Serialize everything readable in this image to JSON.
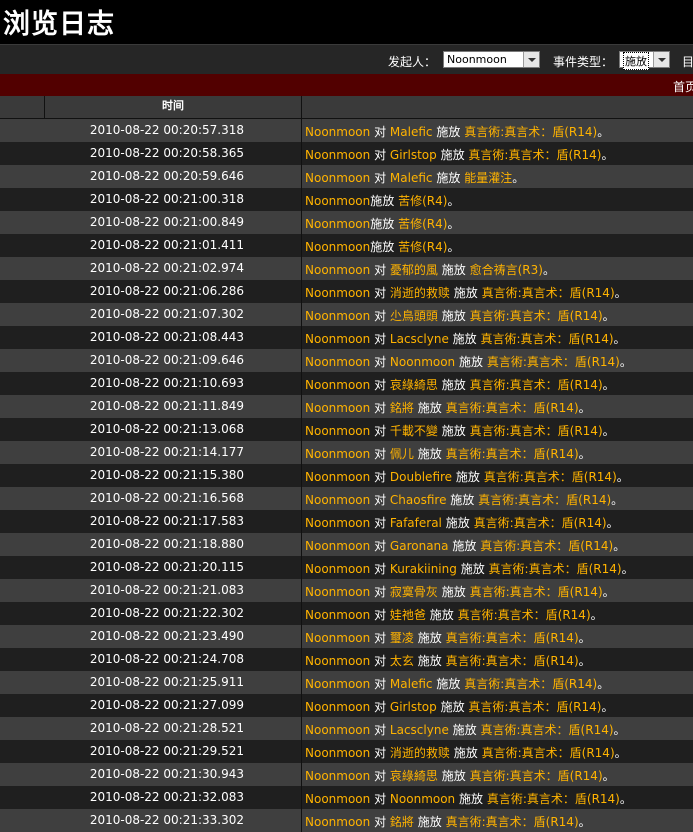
{
  "page": {
    "title": "浏览日志"
  },
  "filters": {
    "initiator_label": "发起人：",
    "initiator_value": "Noonmoon",
    "event_type_label": "事件类型：",
    "event_type_value": "施放",
    "trailing_label": "目"
  },
  "pager": {
    "home": "首页"
  },
  "table": {
    "time_header": "时间",
    "rows": [
      {
        "time": "2010-08-22 00:20:57.318",
        "actor": "Noonmoon",
        "conn": "对",
        "target": "Malefic",
        "verb": "施放",
        "spell": "真言術:真言术：盾(R14)",
        "end": "。"
      },
      {
        "time": "2010-08-22 00:20:58.365",
        "actor": "Noonmoon",
        "conn": "对",
        "target": "Girlstop",
        "verb": "施放",
        "spell": "真言術:真言术：盾(R14)",
        "end": "。"
      },
      {
        "time": "2010-08-22 00:20:59.646",
        "actor": "Noonmoon",
        "conn": "对",
        "target": "Malefic",
        "verb": "施放",
        "spell": "能量灌注",
        "end": "。"
      },
      {
        "time": "2010-08-22 00:21:00.318",
        "actor": "Noonmoon",
        "conn": "",
        "target": "",
        "verb": "施放",
        "spell": "苦修(R4)",
        "end": "。"
      },
      {
        "time": "2010-08-22 00:21:00.849",
        "actor": "Noonmoon",
        "conn": "",
        "target": "",
        "verb": "施放",
        "spell": "苦修(R4)",
        "end": "。"
      },
      {
        "time": "2010-08-22 00:21:01.411",
        "actor": "Noonmoon",
        "conn": "",
        "target": "",
        "verb": "施放",
        "spell": "苦修(R4)",
        "end": "。"
      },
      {
        "time": "2010-08-22 00:21:02.974",
        "actor": "Noonmoon",
        "conn": "对",
        "target": "憂郁的風",
        "verb": "施放",
        "spell": "愈合祷言(R3)",
        "end": "。"
      },
      {
        "time": "2010-08-22 00:21:06.286",
        "actor": "Noonmoon",
        "conn": "对",
        "target": "消逝的救赎",
        "verb": "施放",
        "spell": "真言術:真言术：盾(R14)",
        "end": "。"
      },
      {
        "time": "2010-08-22 00:21:07.302",
        "actor": "Noonmoon",
        "conn": "对",
        "target": "尐鳥頭頭",
        "verb": "施放",
        "spell": "真言術:真言术：盾(R14)",
        "end": "。"
      },
      {
        "time": "2010-08-22 00:21:08.443",
        "actor": "Noonmoon",
        "conn": "对",
        "target": "Lacsclyne",
        "verb": "施放",
        "spell": "真言術:真言术：盾(R14)",
        "end": "。"
      },
      {
        "time": "2010-08-22 00:21:09.646",
        "actor": "Noonmoon",
        "conn": "对",
        "target": "Noonmoon",
        "verb": "施放",
        "spell": "真言術:真言术：盾(R14)",
        "end": "。"
      },
      {
        "time": "2010-08-22 00:21:10.693",
        "actor": "Noonmoon",
        "conn": "对",
        "target": "哀綠綺思",
        "verb": "施放",
        "spell": "真言術:真言术：盾(R14)",
        "end": "。"
      },
      {
        "time": "2010-08-22 00:21:11.849",
        "actor": "Noonmoon",
        "conn": "对",
        "target": "銘將",
        "verb": "施放",
        "spell": "真言術:真言术：盾(R14)",
        "end": "。"
      },
      {
        "time": "2010-08-22 00:21:13.068",
        "actor": "Noonmoon",
        "conn": "对",
        "target": "千載不變",
        "verb": "施放",
        "spell": "真言術:真言术：盾(R14)",
        "end": "。"
      },
      {
        "time": "2010-08-22 00:21:14.177",
        "actor": "Noonmoon",
        "conn": "对",
        "target": "佩儿",
        "verb": "施放",
        "spell": "真言術:真言术：盾(R14)",
        "end": "。"
      },
      {
        "time": "2010-08-22 00:21:15.380",
        "actor": "Noonmoon",
        "conn": "对",
        "target": "Doublefire",
        "verb": "施放",
        "spell": "真言術:真言术：盾(R14)",
        "end": "。"
      },
      {
        "time": "2010-08-22 00:21:16.568",
        "actor": "Noonmoon",
        "conn": "对",
        "target": "Chaosfire",
        "verb": "施放",
        "spell": "真言術:真言术：盾(R14)",
        "end": "。"
      },
      {
        "time": "2010-08-22 00:21:17.583",
        "actor": "Noonmoon",
        "conn": "对",
        "target": "Fafaferal",
        "verb": "施放",
        "spell": "真言術:真言术：盾(R14)",
        "end": "。"
      },
      {
        "time": "2010-08-22 00:21:18.880",
        "actor": "Noonmoon",
        "conn": "对",
        "target": "Garonana",
        "verb": "施放",
        "spell": "真言術:真言术：盾(R14)",
        "end": "。"
      },
      {
        "time": "2010-08-22 00:21:20.115",
        "actor": "Noonmoon",
        "conn": "对",
        "target": "Kurakiining",
        "verb": "施放",
        "spell": "真言術:真言术：盾(R14)",
        "end": "。"
      },
      {
        "time": "2010-08-22 00:21:21.083",
        "actor": "Noonmoon",
        "conn": "对",
        "target": "寂寞骨灰",
        "verb": "施放",
        "spell": "真言術:真言术：盾(R14)",
        "end": "。"
      },
      {
        "time": "2010-08-22 00:21:22.302",
        "actor": "Noonmoon",
        "conn": "对",
        "target": "娃祂爸",
        "verb": "施放",
        "spell": "真言術:真言术：盾(R14)",
        "end": "。"
      },
      {
        "time": "2010-08-22 00:21:23.490",
        "actor": "Noonmoon",
        "conn": "对",
        "target": "璽凌",
        "verb": "施放",
        "spell": "真言術:真言术：盾(R14)",
        "end": "。"
      },
      {
        "time": "2010-08-22 00:21:24.708",
        "actor": "Noonmoon",
        "conn": "对",
        "target": "太玄",
        "verb": "施放",
        "spell": "真言術:真言术：盾(R14)",
        "end": "。"
      },
      {
        "time": "2010-08-22 00:21:25.911",
        "actor": "Noonmoon",
        "conn": "对",
        "target": "Malefic",
        "verb": "施放",
        "spell": "真言術:真言术：盾(R14)",
        "end": "。"
      },
      {
        "time": "2010-08-22 00:21:27.099",
        "actor": "Noonmoon",
        "conn": "对",
        "target": "Girlstop",
        "verb": "施放",
        "spell": "真言術:真言术：盾(R14)",
        "end": "。"
      },
      {
        "time": "2010-08-22 00:21:28.521",
        "actor": "Noonmoon",
        "conn": "对",
        "target": "Lacsclyne",
        "verb": "施放",
        "spell": "真言術:真言术：盾(R14)",
        "end": "。"
      },
      {
        "time": "2010-08-22 00:21:29.521",
        "actor": "Noonmoon",
        "conn": "对",
        "target": "消逝的救赎",
        "verb": "施放",
        "spell": "真言術:真言术：盾(R14)",
        "end": "。"
      },
      {
        "time": "2010-08-22 00:21:30.943",
        "actor": "Noonmoon",
        "conn": "对",
        "target": "哀綠綺思",
        "verb": "施放",
        "spell": "真言術:真言术：盾(R14)",
        "end": "。"
      },
      {
        "time": "2010-08-22 00:21:32.083",
        "actor": "Noonmoon",
        "conn": "对",
        "target": "Noonmoon",
        "verb": "施放",
        "spell": "真言術:真言术：盾(R14)",
        "end": "。"
      },
      {
        "time": "2010-08-22 00:21:33.302",
        "actor": "Noonmoon",
        "conn": "对",
        "target": "銘將",
        "verb": "施放",
        "spell": "真言術:真言术：盾(R14)",
        "end": "。"
      }
    ]
  },
  "colors": {
    "link": "#ffb300",
    "header_bar": "#520000",
    "row_odd": "#3f3f3f",
    "row_even": "#1f1f1f"
  }
}
